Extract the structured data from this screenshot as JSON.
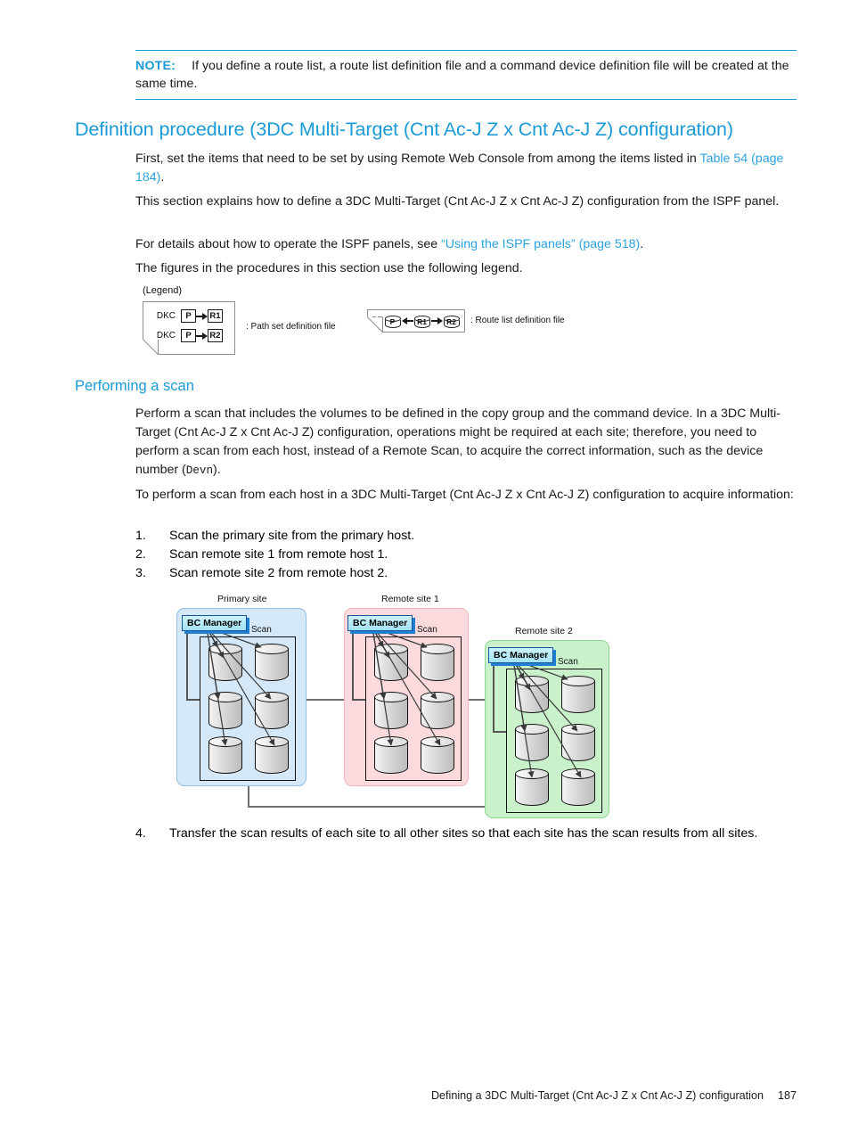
{
  "note": {
    "label": "NOTE:",
    "text": "If you define a route list, a route list definition file and a command device definition file will be created at the same time."
  },
  "headings": {
    "section_title": "Definition procedure (3DC Multi-Target (Cnt Ac-J Z x Cnt Ac-J Z) configuration)",
    "subsection_title": "Performing a scan"
  },
  "paragraphs": {
    "p1_a": "First, set the items that need to be set by using Remote Web Console from among the items listed in ",
    "p1_link": "Table 54 (page 184)",
    "p1_b": ".",
    "p2": "This section explains how to define a 3DC Multi-Target (Cnt Ac-J Z x Cnt Ac-J Z) configuration from the ISPF panel.",
    "p3_a": "For details about how to operate the ISPF panels, see ",
    "p3_link": "“Using the ISPF panels” (page 518)",
    "p3_b": ".",
    "p4": "The figures in the procedures in this section use the following legend.",
    "p5_a": "Perform a scan that includes the volumes to be defined in the copy group and the command device. In a 3DC Multi-Target (Cnt Ac-J Z x Cnt Ac-J Z) configuration, operations might be required at each site; therefore, you need to perform a scan from each host, instead of a Remote Scan, to acquire the correct information, such as the device number (",
    "p5_mono": "Devn",
    "p5_b": ").",
    "p6": "To perform a scan from each host in a 3DC Multi-Target (Cnt Ac-J Z x Cnt Ac-J Z) configuration to acquire information:"
  },
  "steps": [
    {
      "num": "1.",
      "text": "Scan the primary site from the primary host."
    },
    {
      "num": "2.",
      "text": "Scan remote site 1 from remote host 1."
    },
    {
      "num": "3.",
      "text": "Scan remote site 2 from remote host 2."
    },
    {
      "num": "4.",
      "text": "Transfer the scan results of each site to all other sites so that each site has the scan results from all sites."
    }
  ],
  "legend": {
    "caption": "(Legend)",
    "path_set": {
      "rows": [
        {
          "dkc": "DKC",
          "src": "P",
          "dst": "R1"
        },
        {
          "dkc": "DKC",
          "src": "P",
          "dst": "R2"
        }
      ],
      "description": ": Path set definition file"
    },
    "route_list": {
      "prefix": "RT",
      "nodes": [
        "P",
        "R1",
        "R2"
      ],
      "description": ": Route list definition file"
    }
  },
  "figure": {
    "sites": [
      {
        "label": "Primary site",
        "manager_label": "BC Manager",
        "scan_label": "Scan",
        "fill": "#d4e8f8",
        "border": "#8fbfe4"
      },
      {
        "label": "Remote site 1",
        "manager_label": "BC Manager",
        "scan_label": "Scan",
        "fill": "#fadadd",
        "border": "#eeb6bb"
      },
      {
        "label": "Remote site 2",
        "manager_label": "BC Manager",
        "scan_label": "Scan",
        "fill": "#c9f2ca",
        "border": "#8fd694"
      }
    ]
  },
  "footer": {
    "text": "Defining a 3DC Multi-Target (Cnt Ac-J Z x Cnt Ac-J Z) configuration",
    "page": "187"
  },
  "colors": {
    "accent_blue": "#1b9ad6",
    "link_blue": "#2aa3dd",
    "body_text": "#1a1a1a"
  }
}
